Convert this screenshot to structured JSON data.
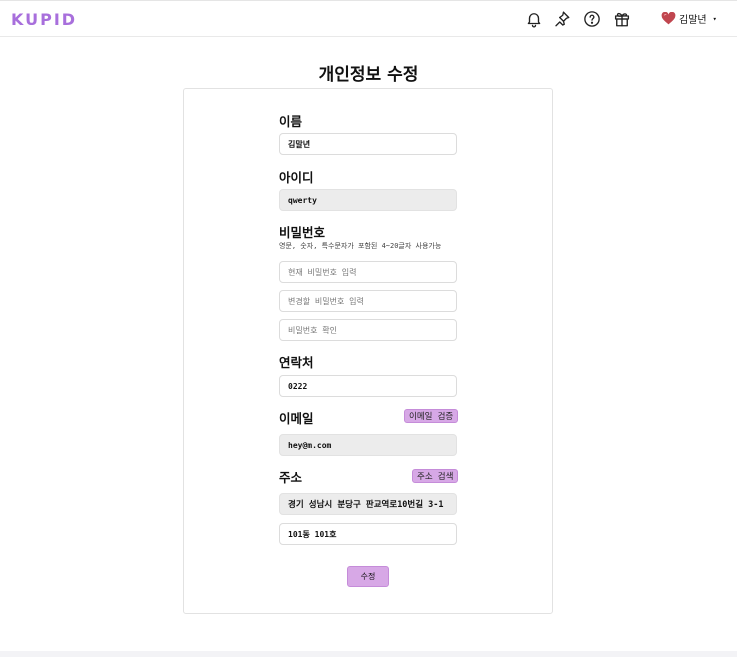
{
  "header": {
    "logo": "KUPID",
    "icons": [
      "bell-icon",
      "pin-icon",
      "help-icon",
      "gift-icon"
    ],
    "user_name": "김말년",
    "user_icon": "heart-icon",
    "caret": "▾"
  },
  "page_title": "개인정보 수정",
  "form": {
    "name": {
      "label": "이름",
      "value": "김말년"
    },
    "user_id": {
      "label": "아이디",
      "value": "qwerty"
    },
    "password": {
      "label": "비밀번호",
      "hint": "영문, 숫자, 특수문자가 포함된 4~20글자 사용가능",
      "current_placeholder": "현재 비밀번호 입력",
      "new_placeholder": "변경할 비밀번호 입력",
      "confirm_placeholder": "비밀번호 확인"
    },
    "phone": {
      "label": "연락처",
      "value": "0222"
    },
    "email": {
      "label": "이메일",
      "verify_button": "이메일 검증",
      "value": "hey@m.com"
    },
    "address": {
      "label": "주소",
      "search_button": "주소 검색",
      "line1": "경기 성남시 분당구 판교역로10번길 3-1",
      "line2": "101동 101호"
    },
    "submit_label": "수정"
  },
  "colors": {
    "accent": "#d7a8e6",
    "logo": "#a86fdc",
    "heart": "#c0464f"
  }
}
